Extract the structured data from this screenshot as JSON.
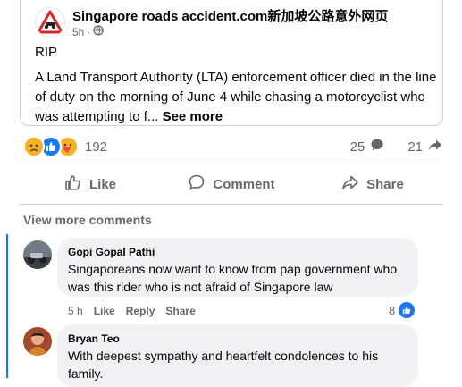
{
  "post": {
    "page_name": "Singapore roads accident.com新加坡公路意外网页",
    "time": "5h",
    "audience_icon": "globe-icon",
    "text_line1": "RIP",
    "text_body": "A Land Transport Authority (LTA) enforcement officer died in the line of duty on the morning of June 4 while chasing a motorcyclist who was attempting to f...",
    "see_more": "See more"
  },
  "stats": {
    "reaction_icons": [
      "sad-icon",
      "like-icon",
      "care-icon"
    ],
    "reaction_count": "192",
    "comments_count": "25",
    "shares_count": "21"
  },
  "actions": {
    "like": "Like",
    "comment": "Comment",
    "share": "Share"
  },
  "view_more_comments": "View more comments",
  "comments": [
    {
      "author": "Gopi Gopal Pathi",
      "text": "Singaporeans now want to know from pap government who was this rider who is not afraid of Singapore law",
      "time": "5 h",
      "like": "Like",
      "reply": "Reply",
      "share": "Share",
      "likes": "8"
    },
    {
      "author": "Bryan Teo",
      "text": "With deepest sympathy and heartfelt condolences to his family."
    }
  ],
  "colors": {
    "accent": "#1877f2",
    "muted": "#65676b",
    "bubble": "#f0f2f5"
  }
}
